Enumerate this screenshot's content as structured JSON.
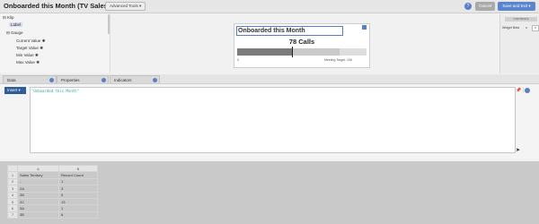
{
  "header": {
    "title": "Onboarded this Month (TV Sales B...",
    "advanced_tools": "Advanced Tools ▾",
    "help": "?",
    "cancel": "Cancel",
    "save_exit": "Save and Exit ▾"
  },
  "tree": {
    "items": [
      "Klip",
      "Label",
      "Gauge",
      "Current Value",
      "Target Value",
      "Min Value",
      "Max Value"
    ]
  },
  "preview": {
    "widget_title": "Onboarded this Month",
    "value_label": "78 Calls",
    "min_label": "0",
    "target_label": "Meeting Target: 106",
    "progress_fraction": 0.54
  },
  "right_panel": {
    "header": "CONTROLS",
    "visible_label": "Widget Beta",
    "x": "x"
  },
  "tabs": [
    "Data",
    "Properties",
    "Indicators"
  ],
  "editor": {
    "insert_label": "Insert ▾",
    "code": "\"Onboarded this Month\"",
    "icons": [
      "pin-icon",
      "more-icon",
      "info-icon"
    ]
  },
  "grid": {
    "col_letters": [
      "A",
      "B"
    ],
    "rows": [
      [
        "1",
        "Sales Territory",
        "Record Count"
      ],
      [
        "2",
        "-",
        "1"
      ],
      [
        "3",
        "2A",
        "3"
      ],
      [
        "4",
        "2B",
        "9"
      ],
      [
        "5",
        "2C",
        "13"
      ],
      [
        "6",
        "3A",
        "1"
      ],
      [
        "7",
        "3B",
        "6"
      ]
    ]
  },
  "colors": {
    "accent": "#5b7fc4",
    "insert_button": "#2d5d9a",
    "code_text": "#2aa59e"
  }
}
